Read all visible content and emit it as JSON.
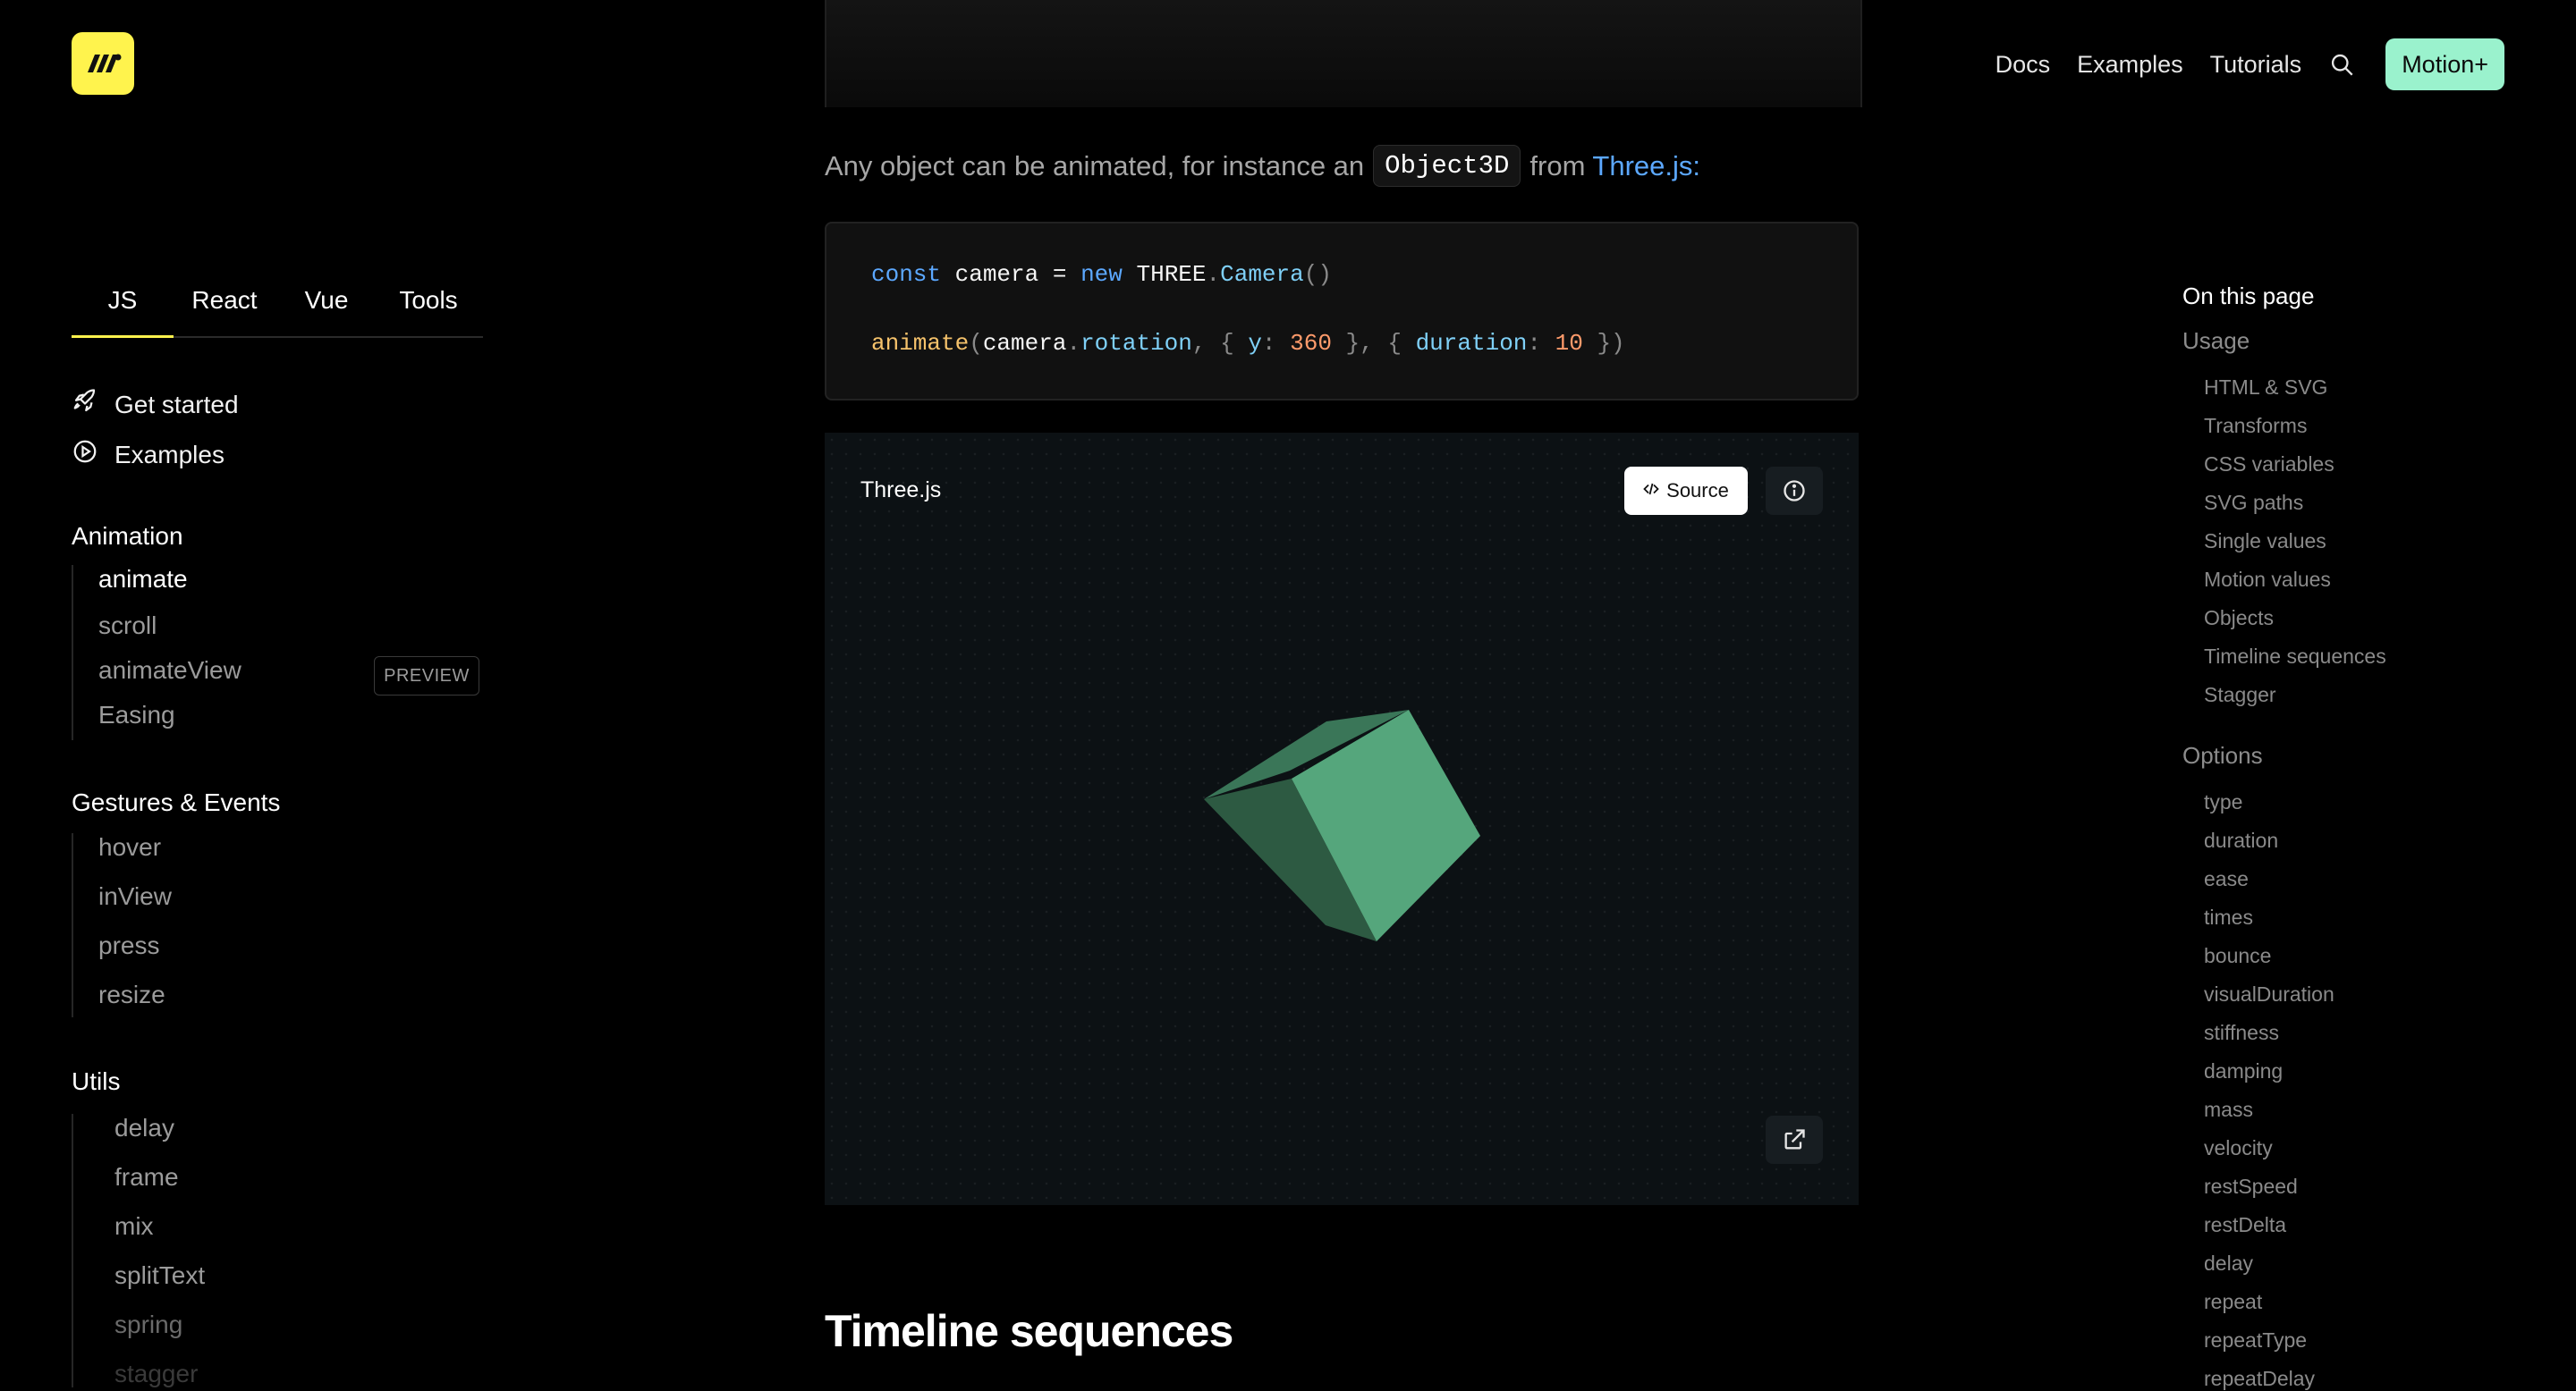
{
  "header": {
    "nav": [
      "Docs",
      "Examples",
      "Tutorials"
    ],
    "cta": "Motion+"
  },
  "sidebar": {
    "tabs": [
      "JS",
      "React",
      "Vue",
      "Tools"
    ],
    "top_links": [
      "Get started",
      "Examples"
    ],
    "sections": [
      {
        "title": "Animation",
        "items": [
          "animate",
          "scroll",
          "animateView",
          "Easing"
        ],
        "badge": "PREVIEW"
      },
      {
        "title": "Gestures & Events",
        "items": [
          "hover",
          "inView",
          "press",
          "resize"
        ]
      },
      {
        "title": "Utils",
        "items": [
          "delay",
          "frame",
          "mix",
          "splitText",
          "spring",
          "stagger"
        ]
      }
    ]
  },
  "main": {
    "paragraph": {
      "before": "Any object can be animated, for instance an",
      "code": "Object3D",
      "mid": "from",
      "link": "Three.js",
      "after": ":"
    },
    "code": {
      "line1": {
        "kw1": "const",
        "var": "camera",
        "eq": " = ",
        "kw2": "new",
        "obj": "THREE",
        "dot": ".",
        "cls": "Camera",
        "paren": "()"
      },
      "line2": {
        "fn": "animate",
        "open": "(",
        "obj": "camera",
        "dot": ".",
        "prop": "rotation",
        "sep1": ", { ",
        "k1": "y",
        "colon1": ": ",
        "v1": "360",
        "sep2": " }, { ",
        "k2": "duration",
        "colon2": ": ",
        "v2": "10",
        "close": " })"
      }
    },
    "demo": {
      "title": "Three.js",
      "source_label": "Source"
    },
    "next_heading": "Timeline sequences"
  },
  "toc": {
    "title": "On this page",
    "sections": [
      {
        "title": "Usage",
        "items": [
          "HTML & SVG",
          "Transforms",
          "CSS variables",
          "SVG paths",
          "Single values",
          "Motion values",
          "Objects",
          "Timeline sequences",
          "Stagger"
        ]
      },
      {
        "title": "Options",
        "items": [
          "type",
          "duration",
          "ease",
          "times",
          "bounce",
          "visualDuration",
          "stiffness",
          "damping",
          "mass",
          "velocity",
          "restSpeed",
          "restDelta",
          "delay",
          "repeat",
          "repeatType",
          "repeatDelay"
        ]
      }
    ]
  },
  "colors": {
    "brand_yellow": "#fff34d",
    "cta_green": "#9af2cd",
    "link_blue": "#5ca8ff",
    "cube_light": "#55a67c",
    "cube_dark": "#2d5a42"
  }
}
